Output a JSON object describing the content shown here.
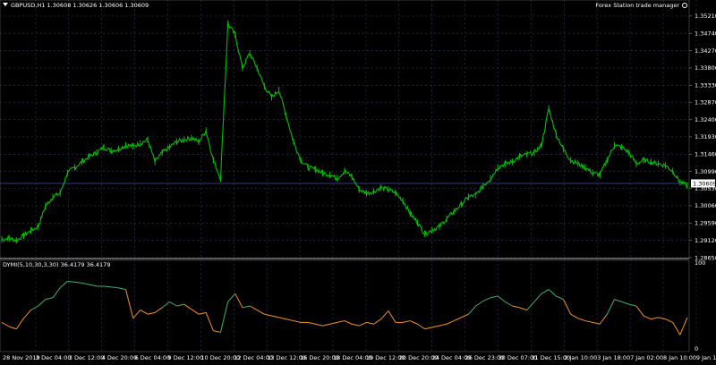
{
  "header": {
    "symbol_line": "GBPUSD,H1  1.30608 1.30626 1.30606 1.30609",
    "trade_manager": "Forex Station trade manager"
  },
  "price_axis": {
    "labels": [
      "1.35210",
      "1.34740",
      "1.34270",
      "1.33800",
      "1.33330",
      "1.32870",
      "1.32400",
      "1.31930",
      "1.31460",
      "1.30990",
      "1.30530",
      "1.30060",
      "1.29590",
      "1.29120",
      "1.28650"
    ],
    "current_price": "1.30609"
  },
  "indicator": {
    "label": "DYMI(5,10,30,3,30) 36.4179 36.4179",
    "axis_labels": [
      "100",
      "0"
    ]
  },
  "time_axis": {
    "labels": [
      "28 Nov 2019",
      "2 Dec 04:00",
      "3 Dec 12:00",
      "4 Dec 20:00",
      "6 Dec 04:00",
      "9 Dec 12:00",
      "10 Dec 20:00",
      "12 Dec 04:00",
      "13 Dec 12:00",
      "16 Dec 20:00",
      "18 Dec 04:00",
      "19 Dec 12:00",
      "20 Dec 20:00",
      "24 Dec 04:00",
      "26 Dec 23:00",
      "30 Dec 07:00",
      "31 Dec 15:00",
      "2 Jan 10:00",
      "3 Jan 18:00",
      "7 Jan 02:00",
      "8 Jan 10:00",
      "9 Jan 18:00"
    ]
  },
  "colors": {
    "background": "#000000",
    "candles": "#00c000",
    "indicator_up": "#3cb371",
    "indicator_down": "#f7931e",
    "grid": "#2b3a55",
    "price_line": "#3b4fb0"
  },
  "chart_data": {
    "type": "line",
    "title": "GBPUSD,H1",
    "ylim": [
      1.2865,
      1.3545
    ],
    "x_labels": [
      "28 Nov 2019",
      "2 Dec 04:00",
      "3 Dec 12:00",
      "4 Dec 20:00",
      "6 Dec 04:00",
      "9 Dec 12:00",
      "10 Dec 20:00",
      "12 Dec 04:00",
      "13 Dec 12:00",
      "16 Dec 20:00",
      "18 Dec 04:00",
      "19 Dec 12:00",
      "20 Dec 20:00",
      "24 Dec 04:00",
      "26 Dec 23:00",
      "30 Dec 07:00",
      "31 Dec 15:00",
      "2 Jan 10:00",
      "3 Jan 18:00",
      "7 Jan 02:00",
      "8 Jan 10:00",
      "9 Jan 18:00"
    ],
    "series": [
      {
        "name": "GBPUSD",
        "values": [
          1.2915,
          1.2918,
          1.2912,
          1.2925,
          1.2938,
          1.295,
          1.3005,
          1.303,
          1.304,
          1.3095,
          1.311,
          1.3125,
          1.314,
          1.315,
          1.3165,
          1.3155,
          1.316,
          1.317,
          1.3168,
          1.3175,
          1.3185,
          1.3125,
          1.315,
          1.3165,
          1.318,
          1.3185,
          1.319,
          1.318,
          1.321,
          1.313,
          1.308,
          1.35,
          1.347,
          1.338,
          1.342,
          1.338,
          1.333,
          1.33,
          1.332,
          1.325,
          1.318,
          1.313,
          1.311,
          1.3105,
          1.3095,
          1.309,
          1.308,
          1.31,
          1.3085,
          1.305,
          1.304,
          1.3045,
          1.3055,
          1.305,
          1.304,
          1.302,
          1.2985,
          1.296,
          1.293,
          1.294,
          1.295,
          1.297,
          1.299,
          1.301,
          1.303,
          1.3035,
          1.306,
          1.308,
          1.311,
          1.312,
          1.3125,
          1.314,
          1.3145,
          1.315,
          1.317,
          1.327,
          1.32,
          1.316,
          1.313,
          1.312,
          1.311,
          1.3095,
          1.309,
          1.313,
          1.317,
          1.3165,
          1.315,
          1.312,
          1.313,
          1.3125,
          1.312,
          1.3115,
          1.31,
          1.307,
          1.3061
        ]
      },
      {
        "name": "DYMI",
        "values": [
          30,
          25,
          22,
          35,
          45,
          50,
          58,
          60,
          72,
          80,
          79,
          78,
          76,
          74,
          74,
          73,
          72,
          70,
          35,
          45,
          40,
          42,
          48,
          55,
          50,
          52,
          46,
          40,
          42,
          20,
          18,
          55,
          65,
          48,
          50,
          45,
          40,
          38,
          36,
          34,
          32,
          30,
          30,
          28,
          26,
          28,
          30,
          32,
          28,
          26,
          30,
          28,
          34,
          44,
          30,
          30,
          32,
          28,
          22,
          24,
          26,
          28,
          32,
          36,
          40,
          50,
          56,
          60,
          62,
          55,
          50,
          48,
          45,
          55,
          65,
          70,
          62,
          58,
          40,
          35,
          32,
          30,
          28,
          40,
          58,
          55,
          52,
          50,
          38,
          34,
          36,
          34,
          30,
          15,
          36
        ]
      }
    ]
  }
}
